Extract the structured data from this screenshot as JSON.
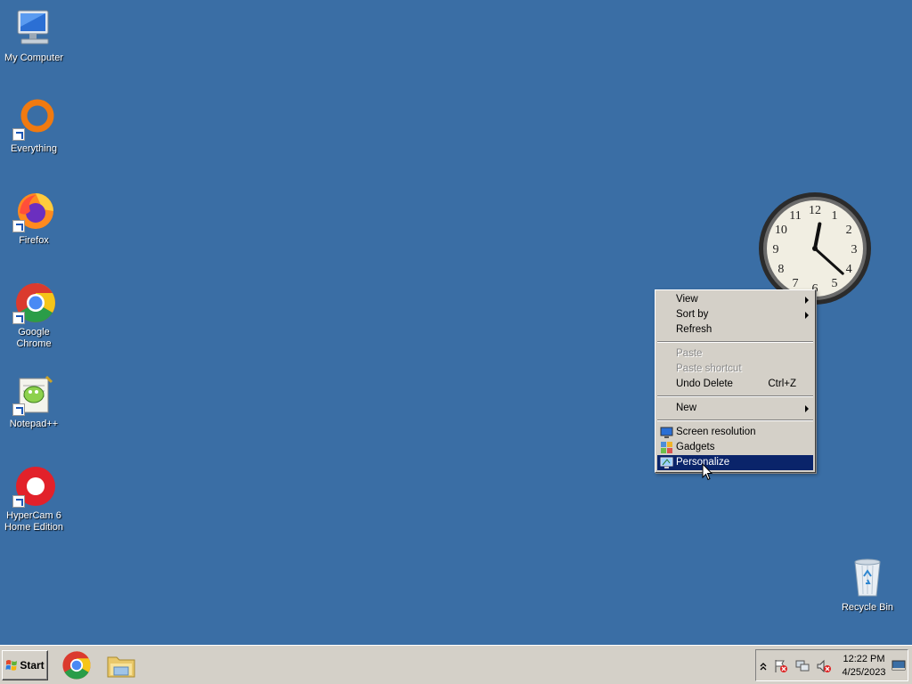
{
  "desktop": {
    "icons": [
      {
        "label": "My Computer"
      },
      {
        "label": "Everything"
      },
      {
        "label": "Firefox"
      },
      {
        "label": "Google Chrome"
      },
      {
        "label": "Notepad++"
      },
      {
        "label": "HyperCam 6\nHome Edition"
      },
      {
        "label": "Recycle Bin"
      }
    ]
  },
  "clock": {
    "time": "12:22",
    "numerals": [
      "12",
      "1",
      "2",
      "3",
      "4",
      "5",
      "6",
      "7",
      "8",
      "9",
      "10",
      "11"
    ]
  },
  "context_menu": {
    "items": [
      {
        "label": "View",
        "submenu": true
      },
      {
        "label": "Sort by",
        "submenu": true
      },
      {
        "label": "Refresh"
      },
      {
        "label": "Paste",
        "disabled": true
      },
      {
        "label": "Paste shortcut",
        "disabled": true
      },
      {
        "label": "Undo Delete",
        "shortcut": "Ctrl+Z"
      },
      {
        "label": "New",
        "submenu": true
      },
      {
        "label": "Screen resolution",
        "icon": "monitor-icon"
      },
      {
        "label": "Gadgets",
        "icon": "gadgets-icon"
      },
      {
        "label": "Personalize",
        "icon": "personalize-icon",
        "highlighted": true
      }
    ]
  },
  "taskbar": {
    "start_label": "Start",
    "pinned": [
      "chrome-icon",
      "folder-icon"
    ],
    "tray": {
      "time": "12:22 PM",
      "date": "4/25/2023",
      "icons": [
        "show-hidden-icons-chevron",
        "action-center-flag-icon",
        "network-icon",
        "volume-muted-icon",
        "show-desktop-icon"
      ]
    }
  },
  "colors": {
    "desktop": "#3a6ea5",
    "highlight": "#0a246a",
    "taskbar": "#d4d0c8"
  }
}
